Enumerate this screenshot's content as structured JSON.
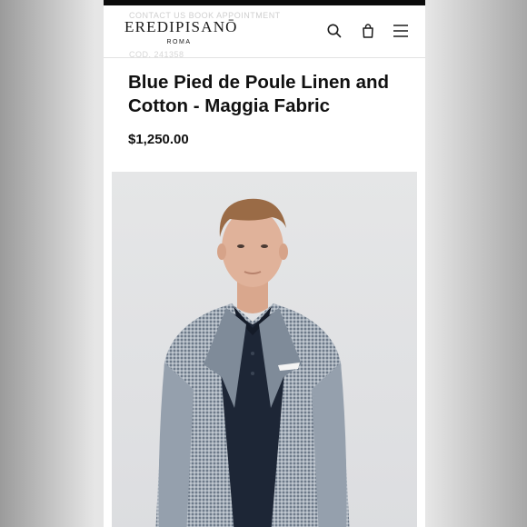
{
  "header": {
    "ghost_text": "CONTACT US BOOK APPOINTMENT",
    "brand": "EREDIPISANŌ",
    "brand_sub": "ROMA",
    "icons": [
      "search-icon",
      "bag-icon",
      "menu-icon"
    ]
  },
  "product": {
    "code": "COD. 241358",
    "title": "Blue Pied de Poule Linen and Cotton - Maggia Fabric",
    "price": "$1,250.00"
  },
  "colors": {
    "background": "#ffffff",
    "text": "#111111",
    "status_bar": "#0b0b0b",
    "photo_bg": "#e0e1e3",
    "jacket": "#8e99a6",
    "polo": "#1d2636"
  }
}
